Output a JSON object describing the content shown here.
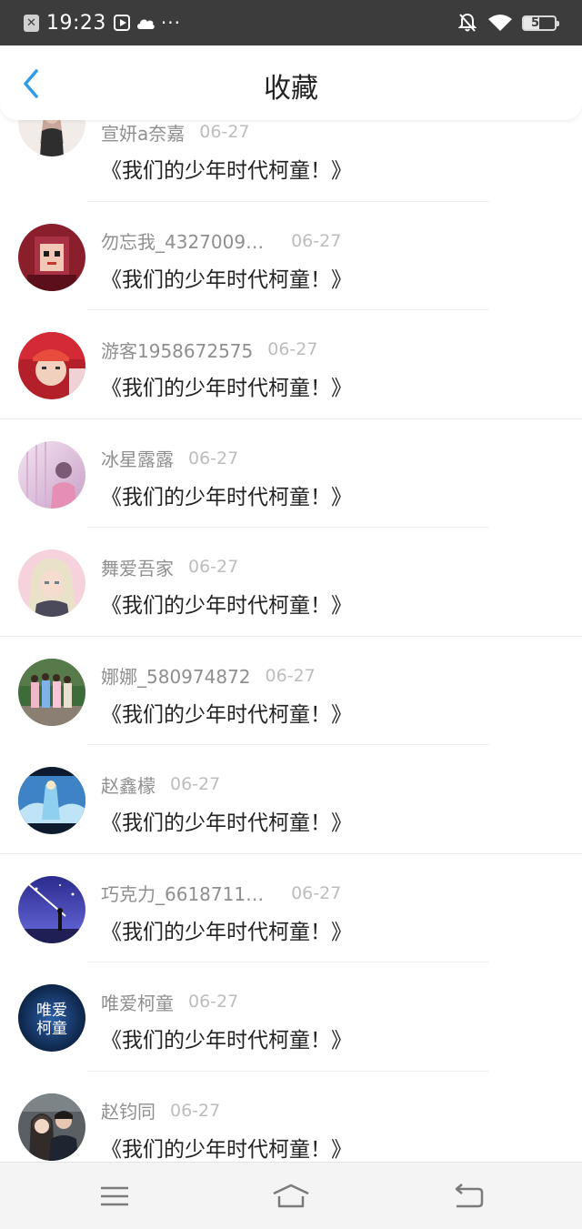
{
  "status_bar": {
    "time": "19:23",
    "more": "···",
    "battery": "50"
  },
  "header": {
    "title": "收藏"
  },
  "items": [
    {
      "username": "宣妍a奈嘉",
      "date": "06-27",
      "title": "《我们的少年时代柯童！》",
      "avatar": "avatar-girl-photo"
    },
    {
      "username": "勿忘我_4327009…",
      "date": "06-27",
      "title": "《我们的少年时代柯童！》",
      "avatar": "avatar-pixel-art"
    },
    {
      "username": "游客1958672575",
      "date": "06-27",
      "title": "《我们的少年时代柯童！》",
      "avatar": "avatar-boy-cap"
    },
    {
      "username": "冰星露露",
      "date": "06-27",
      "title": "《我们的少年时代柯童！》",
      "avatar": "avatar-pink-scene"
    },
    {
      "username": "舞爱吾家",
      "date": "06-27",
      "title": "《我们的少年时代柯童！》",
      "avatar": "avatar-blonde-cosplay"
    },
    {
      "username": "娜娜_580974872",
      "date": "06-27",
      "title": "《我们的少年时代柯童！》",
      "avatar": "avatar-group-photo"
    },
    {
      "username": "赵鑫檬",
      "date": "06-27",
      "title": "《我们的少年时代柯童！》",
      "avatar": "avatar-frozen-elsa"
    },
    {
      "username": "巧克力_6618711…",
      "date": "06-27",
      "title": "《我们的少年时代柯童！》",
      "avatar": "avatar-anime-night-sky"
    },
    {
      "username": "唯爱柯童",
      "date": "06-27",
      "title": "《我们的少年时代柯童！》",
      "avatar": "avatar-text-logo",
      "avatar_text": "唯爱柯童"
    },
    {
      "username": "赵钧同",
      "date": "06-27",
      "title": "《我们的少年时代柯童！》",
      "avatar": "avatar-couple-photo"
    }
  ],
  "nav": {
    "menu_icon": "menu-icon",
    "home_icon": "home-icon",
    "back_icon": "back-icon"
  }
}
